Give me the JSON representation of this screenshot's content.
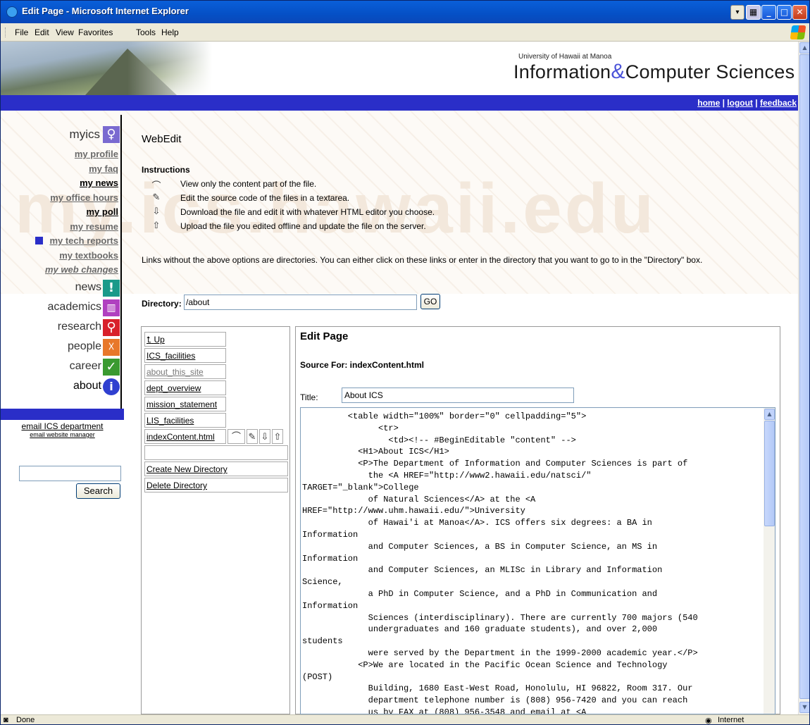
{
  "window": {
    "title": "Edit Page - Microsoft Internet Explorer",
    "menu": [
      "File",
      "Edit",
      "View",
      "Favorites",
      "Tools",
      "Help"
    ]
  },
  "status": {
    "text": "Done",
    "zone": "Internet"
  },
  "header": {
    "university": "University of Hawaii at Manoa",
    "title_part1": "Information",
    "title_part2": "Computer Sciences",
    "links": [
      "home",
      "logout",
      "feedback"
    ]
  },
  "watermark": "my.ics.hawaii.edu",
  "nav": {
    "myics": "myics",
    "sub": [
      {
        "label": "my profile"
      },
      {
        "label": "my faq"
      },
      {
        "label": "my news"
      },
      {
        "label": "my office hours"
      },
      {
        "label": "my poll"
      },
      {
        "label": "my resume"
      },
      {
        "label": "my tech reports"
      },
      {
        "label": "my textbooks"
      },
      {
        "label": "my web changes"
      }
    ],
    "main": [
      {
        "label": "news",
        "color": "#1a9a8a"
      },
      {
        "label": "academics",
        "color": "#b040c0"
      },
      {
        "label": "research",
        "color": "#d8202a"
      },
      {
        "label": "people",
        "color": "#e8782a"
      },
      {
        "label": "career",
        "color": "#3a9a30"
      },
      {
        "label": "about",
        "color": "#3040d0"
      }
    ],
    "email_dept": "email ICS department",
    "email_web": "email website manager",
    "search_button": "Search"
  },
  "main": {
    "heading": "WebEdit",
    "instructions_title": "Instructions",
    "instructions": [
      {
        "icon": "view-icon",
        "text": "View only the content part of the file."
      },
      {
        "icon": "pencil-icon",
        "text": "Edit the source code of the files in a textarea."
      },
      {
        "icon": "download-arrow-icon",
        "text": "Download the file and edit it with whatever HTML editor you choose."
      },
      {
        "icon": "upload-arrow-icon",
        "text": "Upload the file you edited offline and update the file on the server."
      }
    ],
    "links_note": "Links without the above options are directories. You can either click on these links or enter in the directory that you want to go to in the \"Directory\" box.",
    "directory_label": "Directory:",
    "directory_value": "/about",
    "go_button": "GO"
  },
  "files": {
    "up": "Up",
    "items": [
      "ICS_facilities",
      "about_this_site",
      "dept_overview",
      "mission_statement",
      "LIS_facilities",
      "indexContent.html"
    ],
    "create_dir": "Create New Directory",
    "delete_dir": "Delete Directory"
  },
  "editor": {
    "heading": "Edit Page",
    "source_for": "Source For: indexContent.html",
    "title_label": "Title:",
    "title_value": "About ICS",
    "code": "         <table width=\"100%\" border=\"0\" cellpadding=\"5\">\n               <tr>\n                 <td><!-- #BeginEditable \"content\" -->\n           <H1>About ICS</H1>\n           <P>The Department of Information and Computer Sciences is part of\n             the <A HREF=\"http://www2.hawaii.edu/natsci/\"\nTARGET=\"_blank\">College\n             of Natural Sciences</A> at the <A\nHREF=\"http://www.uhm.hawaii.edu/\">University\n             of Hawai'i at Manoa</A>. ICS offers six degrees: a BA in\nInformation\n             and Computer Sciences, a BS in Computer Science, an MS in\nInformation\n             and Computer Sciences, an MLISc in Library and Information\nScience,\n             a PhD in Computer Science, and a PhD in Communication and\nInformation\n             Sciences (interdisciplinary). There are currently 700 majors (540\n             undergraduates and 160 graduate students), and over 2,000\nstudents\n             were served by the Department in the 1999-2000 academic year.</P>\n           <P>We are located in the Pacific Ocean Science and Technology\n(POST)\n             Building, 1680 East-West Road, Honolulu, HI 96822, Room 317. Our\n             department telephone number is (808) 956-7420 and you can reach\n             us by FAX at (808) 956-3548 and email at <A\nHREF=\"mailto:icsinfo@hawaii.edu\">icsinfo@hawaii.edu</A>."
  }
}
